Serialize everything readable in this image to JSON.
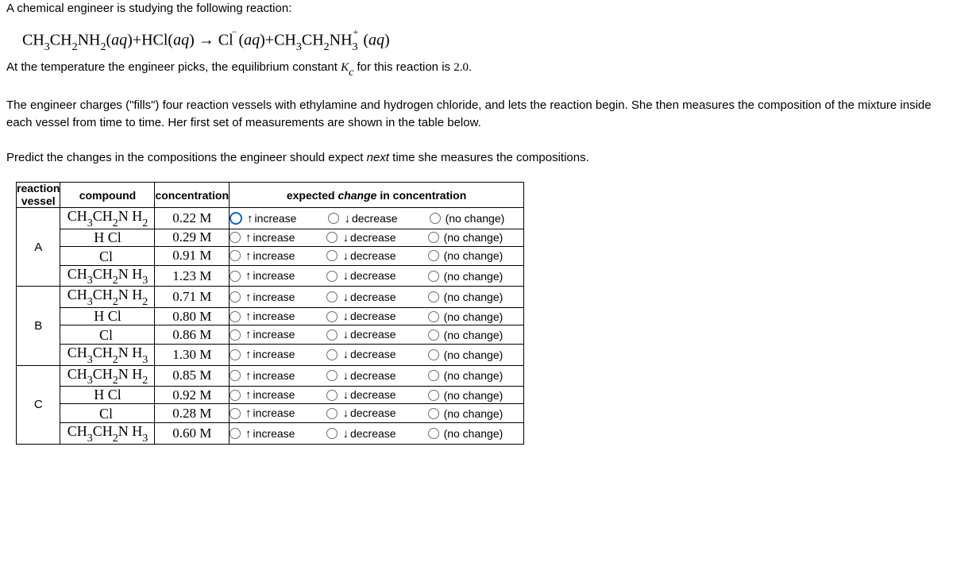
{
  "intro": {
    "line1": "A chemical engineer is studying the following reaction:",
    "line2_pre": "At the temperature the engineer picks, the equilibrium constant ",
    "line2_post": " for this reaction is ",
    "kc_value": "2.0",
    "period": ".",
    "line3": "The engineer charges (\"fills\") four reaction vessels with ethylamine and hydrogen chloride, and lets the reaction begin. She then measures the composition of the mixture inside each vessel from time to time. Her first set of measurements are shown in the table below.",
    "line4_pre": "Predict the changes in the compositions the engineer should expect ",
    "line4_next": "next",
    "line4_post": " time she measures the compositions."
  },
  "equation": {
    "full_plain": "CH3CH2NH2(aq) + HCl(aq) → Cl⁻(aq) + CH3CH2NH3⁺(aq)"
  },
  "headers": {
    "vessel_l1": "reaction",
    "vessel_l2": "vessel",
    "compound": "compound",
    "concentration": "concentration",
    "expected_pre": "expected ",
    "expected_change": "change",
    "expected_post": " in concentration"
  },
  "options": {
    "increase": "increase",
    "decrease": "decrease",
    "nochange": "(no change)"
  },
  "vessels": [
    {
      "name": "A",
      "rows": [
        {
          "compound_key": "ch3ch2nh2",
          "conc": "0.22 M",
          "highlight": true
        },
        {
          "compound_key": "hcl",
          "conc": "0.29 M",
          "highlight": false
        },
        {
          "compound_key": "cl",
          "conc": "0.91 M",
          "highlight": false
        },
        {
          "compound_key": "ch3ch2nh3",
          "conc": "1.23 M",
          "highlight": false
        }
      ]
    },
    {
      "name": "B",
      "rows": [
        {
          "compound_key": "ch3ch2nh2",
          "conc": "0.71 M",
          "highlight": false
        },
        {
          "compound_key": "hcl",
          "conc": "0.80 M",
          "highlight": false
        },
        {
          "compound_key": "cl",
          "conc": "0.86 M",
          "highlight": false
        },
        {
          "compound_key": "ch3ch2nh3",
          "conc": "1.30 M",
          "highlight": false
        }
      ]
    },
    {
      "name": "C",
      "rows": [
        {
          "compound_key": "ch3ch2nh2",
          "conc": "0.85 M",
          "highlight": false
        },
        {
          "compound_key": "hcl",
          "conc": "0.92 M",
          "highlight": false
        },
        {
          "compound_key": "cl",
          "conc": "0.28 M",
          "highlight": false
        },
        {
          "compound_key": "ch3ch2nh3",
          "conc": "0.60 M",
          "highlight": false
        }
      ]
    }
  ],
  "compound_display": {
    "ch3ch2nh2": "CH3CH2NH2",
    "hcl": "H Cl",
    "cl": "Cl",
    "ch3ch2nh3": "CH3CH2NH3"
  }
}
